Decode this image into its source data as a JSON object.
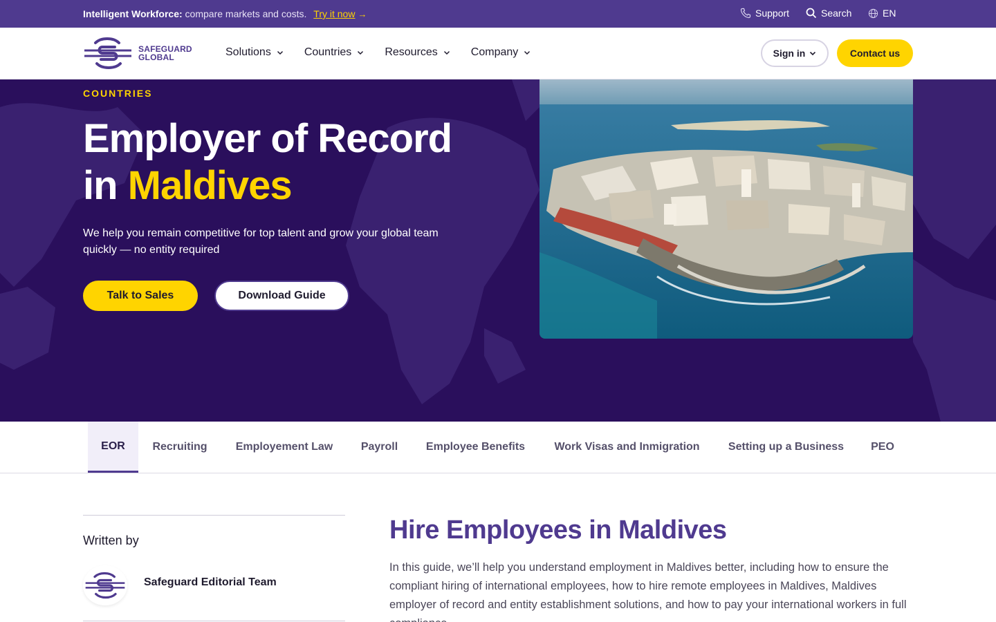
{
  "topbar": {
    "promo_bold": "Intelligent Workforce:",
    "promo_rest": "compare markets and costs.",
    "promo_link": "Try it now",
    "support": "Support",
    "search": "Search",
    "language": "EN"
  },
  "header": {
    "logo_line1": "SAFEGUARD",
    "logo_line2": "GLOBAL",
    "nav": [
      "Solutions",
      "Countries",
      "Resources",
      "Company"
    ],
    "signin": "Sign in",
    "contact": "Contact us"
  },
  "hero": {
    "eyebrow": "COUNTRIES",
    "title_line1": "Employer of Record",
    "title_in": "in",
    "title_highlight": "Maldives",
    "subtitle": "We help you remain competitive for top talent and grow your global team quickly — no entity required",
    "primary_cta": "Talk to Sales",
    "secondary_cta": "Download Guide"
  },
  "tabs": [
    "EOR",
    "Recruiting",
    "Employement Law",
    "Payroll",
    "Employee Benefits",
    "Work Visas and Inmigration",
    "Setting up a Business",
    "PEO"
  ],
  "active_tab": "EOR",
  "aside": {
    "written_by": "Written by",
    "author": "Safeguard Editorial Team"
  },
  "main": {
    "title": "Hire Employees in Maldives",
    "body": "In this guide, we’ll help you understand employment in Maldives better, including how to ensure the compliant hiring of international employees, how to hire remote employees in Maldives, Maldives employer of record and entity establishment solutions, and how to pay your international workers in full compliance."
  },
  "colors": {
    "brand_purple": "#4f3a8f",
    "hero_bg": "#2a0f5c",
    "accent_yellow": "#ffd400"
  }
}
